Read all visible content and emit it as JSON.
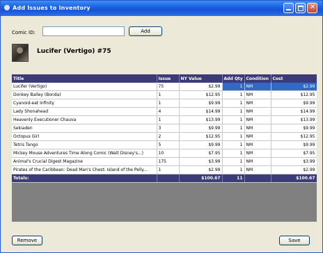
{
  "window": {
    "title": "Add Issues to Inventory"
  },
  "comic_id": {
    "label": "Comic ID:",
    "value": "",
    "add_label": "Add"
  },
  "comic": {
    "title": "Lucifer (Vertigo) #75"
  },
  "table": {
    "columns": [
      "Title",
      "Issue",
      "NY Value",
      "Add Qty",
      "Condition",
      "Cost"
    ],
    "rows": [
      [
        "Lucifer (Vertigo)",
        "75",
        "$2.99",
        "1",
        "NM",
        "$2.99"
      ],
      [
        "Donkey Bailey (Bonda)",
        "1",
        "$12.95",
        "1",
        "NM",
        "$12.95"
      ],
      [
        "Cyanoid-eat Infinity",
        "1",
        "$9.99",
        "1",
        "NM",
        "$9.99"
      ],
      [
        "Lady Shonahead",
        "4",
        "$14.99",
        "1",
        "NM",
        "$14.99"
      ],
      [
        "Heavenly Executioner Chauva",
        "1",
        "$13.99",
        "1",
        "NM",
        "$13.99"
      ],
      [
        "Sekiaden",
        "3",
        "$9.99",
        "1",
        "NM",
        "$9.99"
      ],
      [
        "Octopus Girl",
        "2",
        "$12.95",
        "1",
        "NM",
        "$12.95"
      ],
      [
        "Tetris Tango",
        "5",
        "$9.99",
        "1",
        "NM",
        "$9.99"
      ],
      [
        "Mickey Mouse Adventures Time Along Comic (Walt Disney's...)",
        "10",
        "$7.95",
        "1",
        "NM",
        "$7.95"
      ],
      [
        "Animal's Crucial Digest Magazine",
        "175",
        "$3.99",
        "1",
        "NM",
        "$3.99"
      ],
      [
        "Pirates of the Caribbean: Dead Man's Chest: Island of the Pelly...",
        "1",
        "$2.99",
        "1",
        "NM",
        "$2.99"
      ]
    ],
    "totals": [
      "Totals:",
      "",
      "$100.67",
      "11",
      "",
      "$100.67"
    ]
  },
  "buttons": {
    "remove": "Remove",
    "save": "Save"
  }
}
